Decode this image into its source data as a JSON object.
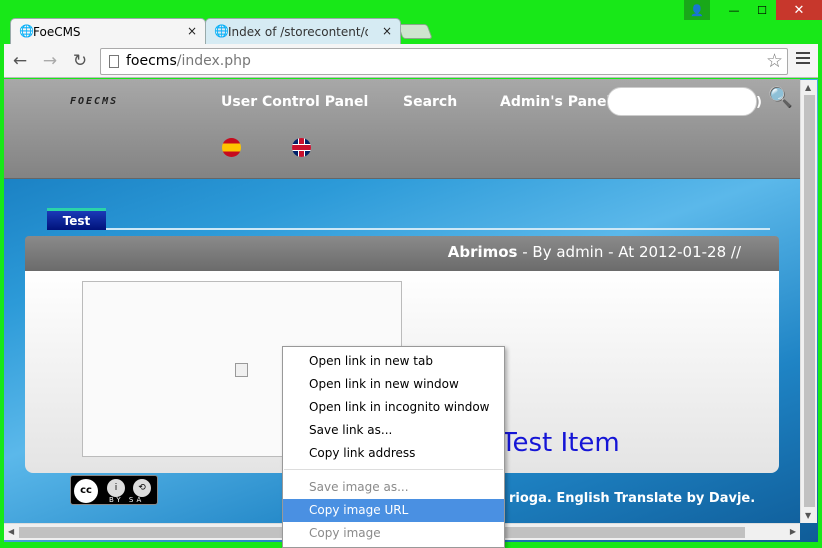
{
  "window": {
    "controls": {
      "user": "👤",
      "minimize": "—",
      "maximize": "☐",
      "close": "✕"
    }
  },
  "tabs": [
    {
      "title": "FoeCMS",
      "close": "×",
      "icon": "globe-icon"
    },
    {
      "title": "Index of /storecontent/dow",
      "close": "×",
      "icon": "globe-icon"
    }
  ],
  "toolbar": {
    "back": "←",
    "forward": "→",
    "reload": "↻",
    "url_host": "foecms",
    "url_path": "/index.php",
    "star": "☆"
  },
  "site": {
    "logo": "FOECMS",
    "nav": [
      "User Control Panel",
      "Search",
      "Admin's Panel"
    ],
    "search_paren": ")",
    "search_icon": "magnifier-icon",
    "flags": [
      "es-flag",
      "uk-flag"
    ],
    "section_tab": "Test",
    "post": {
      "title_bold": "Abrimos",
      "title_rest": " - By admin - At 2012-01-28 //"
    },
    "item_title": "Test Item",
    "cc": {
      "cc": "cc",
      "by": "i",
      "sa": "⟲",
      "label": "BY  SA"
    },
    "footer": "rioga. English Translate by Davje."
  },
  "context_menu": {
    "items": [
      {
        "label": "Open link in new tab",
        "disabled": false
      },
      {
        "label": "Open link in new window",
        "disabled": false
      },
      {
        "label": "Open link in incognito window",
        "disabled": false
      },
      {
        "label": "Save link as...",
        "disabled": false
      },
      {
        "label": "Copy link address",
        "disabled": false
      },
      {
        "label": "Save image as...",
        "disabled": true
      },
      {
        "label": "Copy image URL",
        "disabled": false,
        "highlighted": true
      },
      {
        "label": "Copy image",
        "disabled": true
      }
    ]
  },
  "colors": {
    "accent": "#18e818",
    "highlight": "#4a90e2",
    "link": "#1515d6"
  }
}
